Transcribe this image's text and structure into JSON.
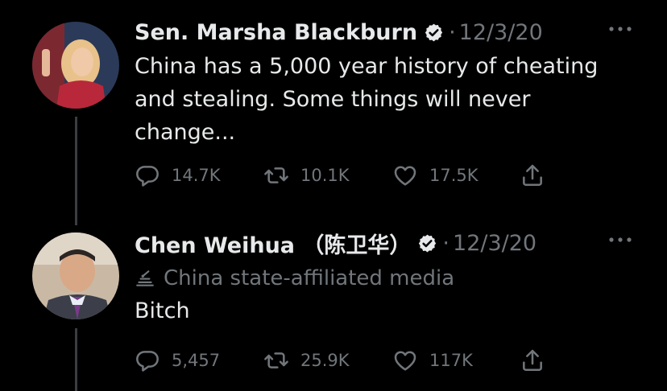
{
  "tweets": [
    {
      "author": "Sen. Marsha Blackburn",
      "separator": "·",
      "date": "12/3/20",
      "text_lines": [
        "China has a 5,000 year history of cheating",
        "and stealing. Some things will never",
        "change..."
      ],
      "replies": "14.7K",
      "retweets": "10.1K",
      "likes": "17.5K"
    },
    {
      "author": "Chen Weihua （陈卫华）",
      "separator": "·",
      "date": "12/3/20",
      "affiliation": "China state-affiliated media",
      "text_lines": [
        "Bitch"
      ],
      "replies": "5,457",
      "retweets": "25.9K",
      "likes": "117K"
    }
  ],
  "icons": {
    "verified": "verified-badge-icon",
    "more": "more-icon",
    "reply": "reply-icon",
    "retweet": "retweet-icon",
    "like": "like-icon",
    "share": "share-icon",
    "affiliation": "state-media-icon"
  },
  "colors": {
    "background": "#000000",
    "primary_text": "#e7e9ea",
    "secondary_text": "#71767b",
    "thread_line": "#3a3d41"
  }
}
